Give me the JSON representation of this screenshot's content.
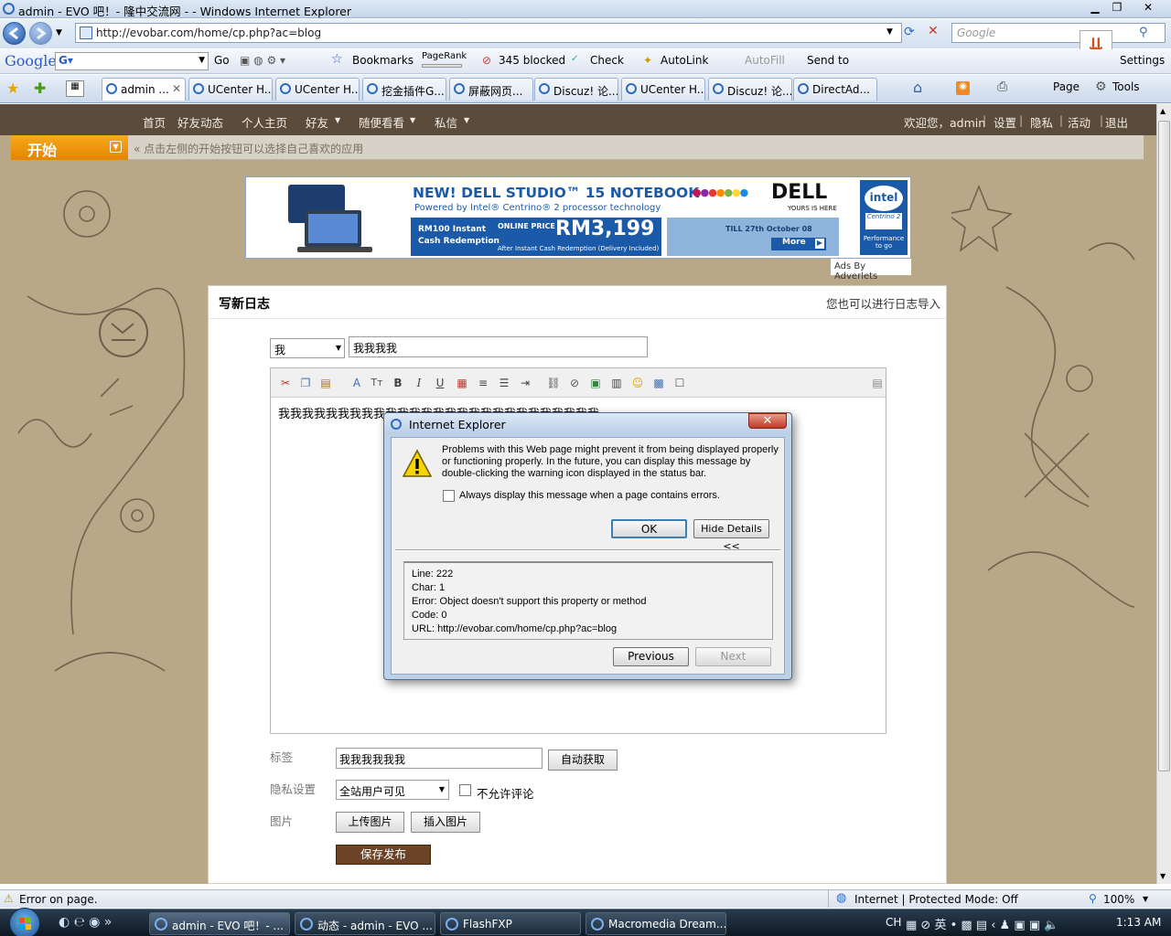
{
  "window": {
    "title": "admin - EVO 吧！- 隆中交流网 - - Windows Internet Explorer",
    "minimize": "▁",
    "maximize": "❐",
    "close": "✕"
  },
  "address": {
    "url": "http://evobar.com/home/cp.php?ac=blog",
    "search_placeholder": "Google"
  },
  "google_toolbar": {
    "logo": "Google",
    "go": "Go",
    "bookmarks": "Bookmarks",
    "pagerank": "PageRank",
    "blocked": "345 blocked",
    "check": "Check",
    "autolink": "AutoLink",
    "autofill": "AutoFill",
    "sendto": "Send to",
    "settings": "Settings"
  },
  "tabs": [
    {
      "label": "admin ..."
    },
    {
      "label": "UCenter H..."
    },
    {
      "label": "UCenter H..."
    },
    {
      "label": "挖金插件G..."
    },
    {
      "label": "屏蔽网页..."
    },
    {
      "label": "Discuz! 论..."
    },
    {
      "label": "UCenter H..."
    },
    {
      "label": "Discuz! 论..."
    },
    {
      "label": "DirectAd..."
    }
  ],
  "command_bar": {
    "page": "Page",
    "tools": "Tools"
  },
  "site_nav": {
    "items": [
      "首页",
      "好友动态",
      "个人主页",
      "好友",
      "随便看看",
      "私信"
    ],
    "right": [
      "欢迎您，admin",
      "设置",
      "隐私",
      "活动",
      "退出"
    ]
  },
  "start": {
    "label": "开始",
    "hint": "« 点击左侧的开始按钮可以选择自己喜欢的应用"
  },
  "ad": {
    "headline": "NEW! DELL STUDIO™ 15 NOTEBOOK",
    "sub": "Powered by Intel® Centrino® 2 processor technology",
    "brand": "DELL",
    "tagline": "YOURS IS HERE",
    "rebate_line1": "RM100 Instant",
    "rebate_line2": "Cash Redemption",
    "price_label": "ONLINE PRICE",
    "price": "RM3,199",
    "price_note": "After Instant Cash Redemption (Delivery Included)",
    "till": "TILL 27th October 08",
    "more": "More",
    "intel": "intel",
    "centrino": "Centrino 2",
    "perf": "Performance to go",
    "footer": "Ads By Adverlets"
  },
  "blog": {
    "title": "写新日志",
    "import": "您也可以进行日志导入",
    "category": "我",
    "subject": "我我我我",
    "content": "我我我我我我我我我我我我我我我我我我我我我我我我我我我",
    "tags_label": "标签",
    "tags_value": "我我我我我我",
    "auto_fetch": "自动获取",
    "privacy_label": "隐私设置",
    "privacy_value": "全站用户可见",
    "no_comment": "不允许评论",
    "image_label": "图片",
    "upload": "上传图片",
    "insert": "插入图片",
    "submit": "保存发布"
  },
  "dialog": {
    "title": "Internet Explorer",
    "message": "Problems with this Web page might prevent it from being displayed properly or functioning properly. In the future, you can display this message by double-clicking the warning icon displayed in the status bar.",
    "checkbox": "Always display this message when a page contains errors.",
    "ok": "OK",
    "hide_details": "Hide Details <<",
    "details": {
      "line": "Line:  222",
      "char": "Char:  1",
      "error": "Error:  Object doesn't support this property or method",
      "code": "Code: 0",
      "url": "URL:  http://evobar.com/home/cp.php?ac=blog"
    },
    "previous": "Previous",
    "next": "Next"
  },
  "status": {
    "error": "Error on page.",
    "zone": "Internet | Protected Mode: Off",
    "zoom": "100%"
  },
  "taskbar": {
    "tasks": [
      "admin - EVO 吧！- ...",
      "动态 - admin - EVO ...",
      "FlashFXP",
      "Macromedia Dream..."
    ],
    "lang": "CH",
    "time": "1:13 AM"
  },
  "colors": {
    "page_bg": "#b8a888",
    "nav_bg": "#5b4b3b",
    "start_orange": "#f39c12",
    "submit_brown": "#6b4428",
    "ad_blue": "#1a5aa8"
  }
}
